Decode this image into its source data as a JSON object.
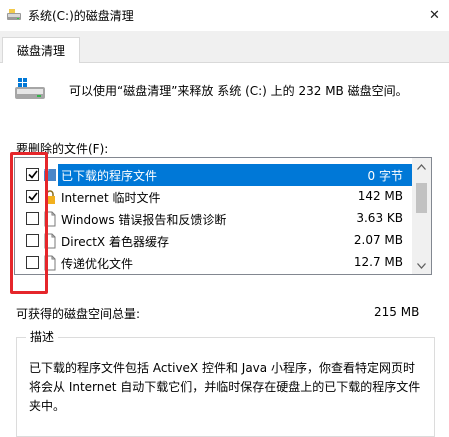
{
  "window": {
    "title": "系统(C:)的磁盘清理",
    "close_glyph": "✕"
  },
  "tab": {
    "label": "磁盘清理"
  },
  "intro": {
    "text": "可以使用“磁盘清理”来释放 系统 (C:) 上的 232 MB 磁盘空间。"
  },
  "files_section": {
    "label": "要删除的文件(F):"
  },
  "files": [
    {
      "name": "已下载的程序文件",
      "size": "0 字节",
      "checked": true,
      "selected": true,
      "icon": "folder-icon"
    },
    {
      "name": "Internet 临时文件",
      "size": "142 MB",
      "checked": true,
      "selected": false,
      "icon": "lock-icon"
    },
    {
      "name": "Windows 错误报告和反馈诊断",
      "size": "3.63 KB",
      "checked": false,
      "selected": false,
      "icon": "document-icon"
    },
    {
      "name": "DirectX 着色器缓存",
      "size": "2.07 MB",
      "checked": false,
      "selected": false,
      "icon": "document-icon"
    },
    {
      "name": "传递优化文件",
      "size": "12.7 MB",
      "checked": false,
      "selected": false,
      "icon": "document-icon"
    }
  ],
  "total": {
    "label": "可获得的磁盘空间总量:",
    "value": "215 MB"
  },
  "description": {
    "title": "描述",
    "text": "已下载的程序文件包括 ActiveX 控件和 Java 小程序，你查看特定网页时将会从 Internet 自动下载它们，并临时保存在硬盘上的已下载的程序文件夹中。"
  },
  "colors": {
    "selection": "#0078d7",
    "highlight_box": "#e5262b"
  }
}
